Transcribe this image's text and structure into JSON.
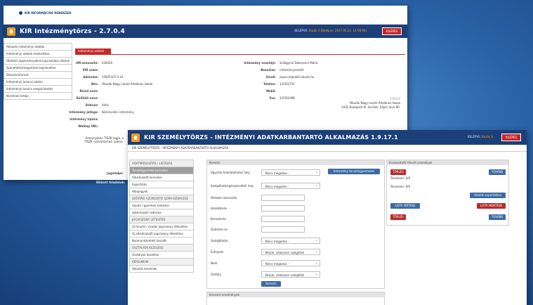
{
  "window1": {
    "logo_text": "KIR INFORMÁCIÓS RENDSZER",
    "title": "KIR Intézménytörzs - 2.7.0.4",
    "login_prefix": "BELÉPVE:",
    "login_user": "Kozák A (Belépve: 2017.05.22. 14:58:08)",
    "logout_label": "KILÉPÉS",
    "sidebar": [
      "Aktuális intézményi adatok",
      "Intézményi adatok módosítása",
      "Oktatási igazolványokkal kapcsolatos adatok",
      "Szünetelés/megszűnés bejelentése",
      "Dokumentumok",
      "Intézményi tanácsi adatai",
      "Intézményi tanács megszüntetés",
      "Kérelmek listája"
    ],
    "tab_label": "Intézményi adatok",
    "fields_left": [
      {
        "label": "OM azonosító:",
        "value": "034020"
      },
      {
        "label": "PIR szám:",
        "value": ""
      },
      {
        "label": "Adószám:",
        "value": "15835107-2-41"
      },
      {
        "label": "Név:",
        "value": "Óbudai Nagy László Általános Iskola"
      },
      {
        "label": "Rövid neve:",
        "value": ""
      },
      {
        "label": "Külföldi neve:",
        "value": ""
      },
      {
        "label": "Státusz:",
        "value": "Aktív"
      },
      {
        "label": "Intézmény jellege:",
        "value": "Köznevelési intézmény"
      },
      {
        "label": "Intézmény típusa:",
        "value": ""
      },
      {
        "label": "Weblap URL:",
        "value": ""
      }
    ],
    "fields_right": [
      {
        "label": "Intézmény vezetője:",
        "value": "Szilágyiné Debreceni Mária"
      },
      {
        "label": "Beosztás:",
        "value": "intézményvezető"
      },
      {
        "label": "Email:",
        "value": "zapor-m@obdi-obuda.hu"
      },
      {
        "label": "Telefon:",
        "value": "1/2502710"
      },
      {
        "label": "Mobil:",
        "value": ""
      },
      {
        "label": "Fax:",
        "value": "1/2501088"
      }
    ],
    "extra_labels": [
      "Amennyiben TISZK tagja, a TISZK nyilvántartási száma:",
      "Jogelődjei:",
      "Ellátott feladatok:"
    ],
    "address_num": "034020",
    "address_name": "Óbudai Nagy László Általános Iskola",
    "address_line": "1032 Budapest III. kerület, Zápor utca 90."
  },
  "window2": {
    "logo_text": "KIR INFORMÁCIÓS",
    "title": "KIR SZEMÉLYTÖRZS - INTÉZMÉNYI ADATKARBANTARTÓ ALKALMAZÁS 1.9.17.1",
    "login_prefix": "BELÉPVE:",
    "login_user": "Kozák A",
    "logout_label": "KILÉPÉS",
    "breadcrumb": "KIR SZEMÉLYTÖRZS - INTÉZMÉNYI ADATKARBANTARTÓ ALKALMAZÁS",
    "sidebar": [
      {
        "text": "ADATMÓDOSÍTÁS / LISTÁZÁS",
        "kind": "head"
      },
      {
        "text": "Tanuló/gyermek keresése",
        "kind": "active"
      },
      {
        "text": "Alkalmazott keresése",
        "kind": "item"
      },
      {
        "text": "Exportálás",
        "kind": "item"
      },
      {
        "text": "Hibajegyek",
        "kind": "item"
      },
      {
        "text": "OKTATÁSI AZONOSÍTÓ SZÁM IGÉNYLÉSE",
        "kind": "head"
      },
      {
        "text": "tanuló / gyermek számára",
        "kind": "item"
      },
      {
        "text": "alkalmazott számára",
        "kind": "item"
      },
      {
        "text": "JOGVISZONY LÉTESÍTÉS",
        "kind": "head"
      },
      {
        "text": "Új tanulói / óvodai jogviszony létesítése",
        "kind": "item"
      },
      {
        "text": "Új alkalmazotti jogviszony létesítése",
        "kind": "item"
      },
      {
        "text": "Nyomonkövetett tanulók",
        "kind": "item"
      },
      {
        "text": "OSZTÁLYOK KEZELÉSE",
        "kind": "head"
      },
      {
        "text": "Osztályok kezelése",
        "kind": "item"
      },
      {
        "text": "KÉRELMEIM",
        "kind": "head"
      },
      {
        "text": "Aktuális kérelmek",
        "kind": "item"
      }
    ],
    "search": {
      "panel_title": "Keresés",
      "labels": {
        "site": "Ügyvitel feladatellátási hely",
        "service": "Szolgáltatásigénybevételi hely",
        "oid": "Oktatási azonosító",
        "lastname": "Vezetéknév",
        "firstname": "Keresztnév",
        "birthyear": "Születési év",
        "service2": "Szolgáltatás",
        "grade": "Évfolyam",
        "gender": "Nem",
        "class": "Osztály"
      },
      "values": {
        "site": "- Nincs megadva -",
        "service": "- Nincs megadva -",
        "service2": "- Nincs megadva -",
        "grade": "- Kérjük, válasszon szolgáltat",
        "gender": "- Nincs megadva -",
        "class": "- Kérjük, válasszon szolgáltat"
      },
      "student_button": "Intézmény tanulói/gyermekei",
      "search_button": "Keresés",
      "results_title": "Keresési eredmények"
    },
    "right_panel": {
      "title": "Kiválasztott/ felvett személyek",
      "delete1": "TÖRLÉS",
      "next1": "TOVÁBB",
      "count1": "Összesen: 0/0",
      "count2": "Összesen: 0/0",
      "add_button": "Adatok exportálása",
      "list_clear": "LISTA ÜRÍTÉSE",
      "list_save": "LISTA MENTÉSE",
      "delete2": "TÖRLÉS",
      "next2": "TOVÁBB"
    }
  }
}
